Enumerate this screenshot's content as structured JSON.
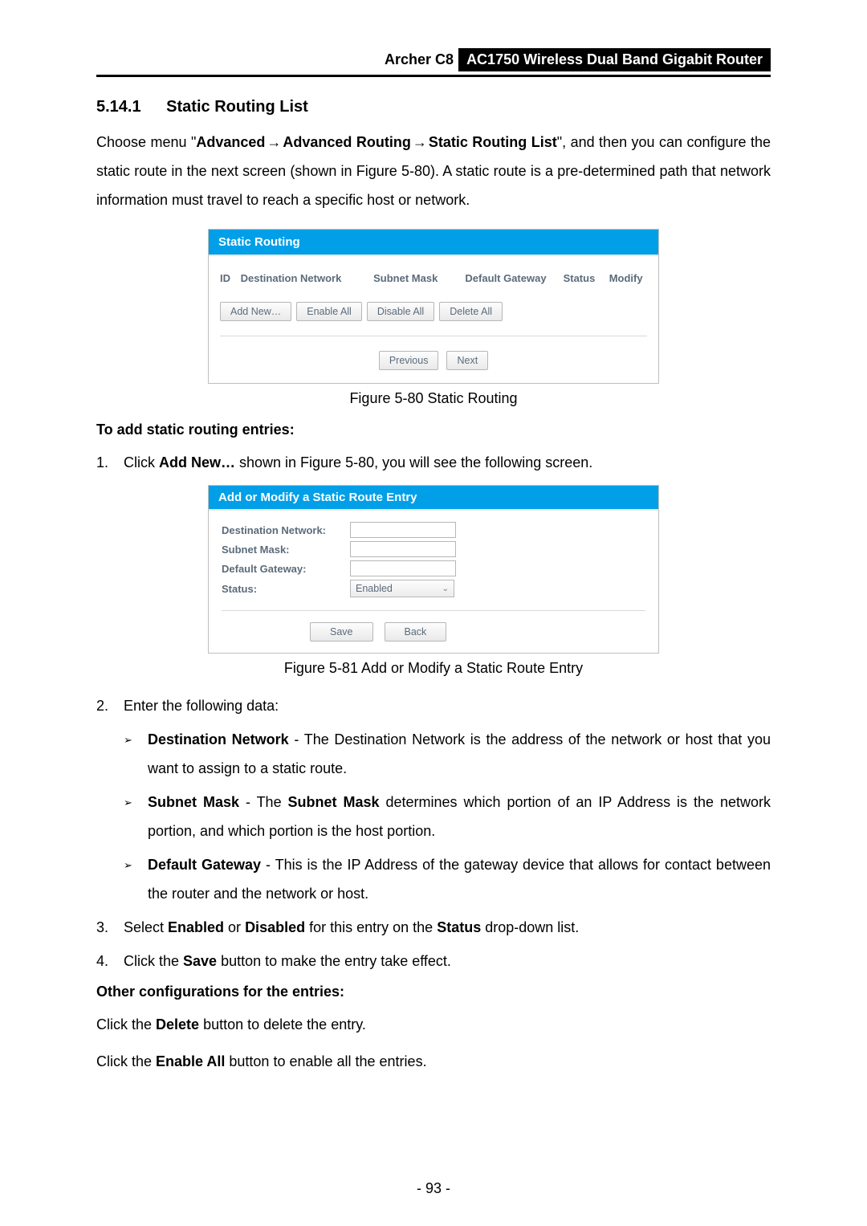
{
  "header": {
    "model": "Archer C8",
    "product": "AC1750 Wireless Dual Band Gigabit Router"
  },
  "section": {
    "number": "5.14.1",
    "title": "Static Routing List"
  },
  "intro": {
    "prefix": "Choose menu \"",
    "nav1": "Advanced",
    "nav2": "Advanced Routing",
    "nav3": "Static Routing List",
    "suffix": "\", and then you can configure the static route in the next screen (shown in Figure 5-80). A static route is a pre-determined path that network information must travel to reach a specific host or network."
  },
  "fig80": {
    "title": "Static Routing",
    "cols": {
      "id": "ID",
      "dest": "Destination Network",
      "sub": "Subnet Mask",
      "gw": "Default Gateway",
      "status": "Status",
      "modify": "Modify"
    },
    "buttons": {
      "add": "Add New…",
      "enable_all": "Enable All",
      "disable_all": "Disable All",
      "delete_all": "Delete All",
      "previous": "Previous",
      "next": "Next"
    },
    "caption": "Figure 5-80 Static Routing"
  },
  "add_heading": "To add static routing entries:",
  "step1": {
    "n": "1.",
    "pre": "Click ",
    "bold": "Add New…",
    "post": " shown in Figure 5-80, you will see the following screen."
  },
  "fig81": {
    "title": "Add or Modify a Static Route Entry",
    "labels": {
      "dest": "Destination Network:",
      "sub": "Subnet Mask:",
      "gw": "Default Gateway:",
      "status": "Status:"
    },
    "status_value": "Enabled",
    "buttons": {
      "save": "Save",
      "back": "Back"
    },
    "caption": "Figure 5-81 Add or Modify a Static Route Entry"
  },
  "step2": {
    "n": "2.",
    "text": "Enter the following data:"
  },
  "bullets": {
    "b1_label": "Destination Network",
    "b1_text": " - The Destination Network is the address of the network or host that you want to assign to a static route.",
    "b2_label": "Subnet Mask",
    "b2_pre": " - The ",
    "b2_bold": "Subnet Mask",
    "b2_post": " determines which portion of an IP Address is the network portion, and which portion is the host portion.",
    "b3_label": "Default Gateway",
    "b3_text": " - This is the IP Address of the gateway device that allows for contact between the router and the network or host."
  },
  "step3": {
    "n": "3.",
    "pre": "Select ",
    "b1": "Enabled",
    "mid1": " or ",
    "b2": "Disabled",
    "mid2": " for this entry on the ",
    "b3": "Status",
    "post": " drop-down list."
  },
  "step4": {
    "n": "4.",
    "pre": "Click the ",
    "b1": "Save",
    "post": " button to make the entry take effect."
  },
  "other_heading": "Other configurations for the entries:",
  "other1": {
    "pre": "Click the ",
    "b": "Delete",
    "post": " button to delete the entry."
  },
  "other2": {
    "pre": "Click the ",
    "b": "Enable All",
    "post": " button to enable all the entries."
  },
  "page_number": "- 93 -"
}
